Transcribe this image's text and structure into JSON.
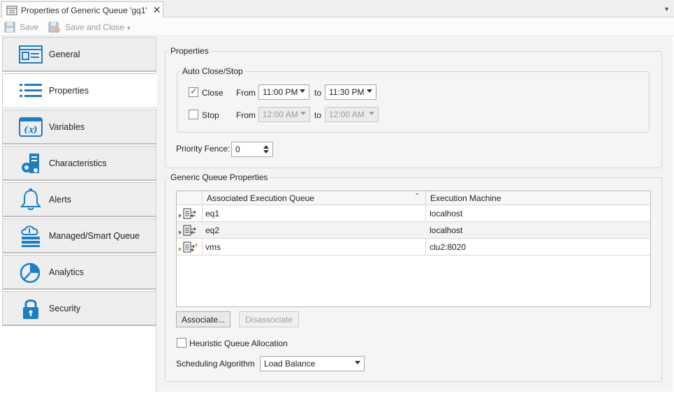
{
  "tab": {
    "title": "Properties of Generic Queue 'gq1'",
    "close": "✕"
  },
  "toolbar": {
    "save": "Save",
    "save_close": "Save and Close"
  },
  "nav": [
    {
      "label": "General",
      "icon": "general-icon"
    },
    {
      "label": "Properties",
      "icon": "list-icon"
    },
    {
      "label": "Variables",
      "icon": "variables-icon"
    },
    {
      "label": "Characteristics",
      "icon": "characteristics-icon"
    },
    {
      "label": "Alerts",
      "icon": "bell-icon"
    },
    {
      "label": "Managed/Smart Queue",
      "icon": "cloud-server-icon"
    },
    {
      "label": "Analytics",
      "icon": "pie-chart-icon"
    },
    {
      "label": "Security",
      "icon": "lock-icon"
    }
  ],
  "properties": {
    "title": "Properties",
    "autoclose": {
      "title": "Auto Close/Stop",
      "close_label": "Close",
      "close_checked": true,
      "stop_label": "Stop",
      "stop_checked": false,
      "from": "From",
      "to": "to",
      "close_from": "11:00 PM",
      "close_to": "11:30 PM",
      "stop_from": "12:00 AM",
      "stop_to": "12:00 AM"
    },
    "priority_label": "Priority Fence:",
    "priority_value": "0"
  },
  "gq": {
    "title": "Generic Queue Properties",
    "columns": [
      "Associated Execution Queue",
      "Execution Machine"
    ],
    "rows": [
      {
        "queue": "eq1",
        "machine": "localhost"
      },
      {
        "queue": "eq2",
        "machine": "localhost"
      },
      {
        "queue": "vms",
        "machine": "clu2:8020"
      }
    ],
    "associate": "Associate...",
    "disassociate": "Disassociate",
    "heuristic_label": "Heuristic Queue Allocation",
    "sched_label": "Scheduling Algorithm",
    "sched_value": "Load Balance"
  },
  "colors": {
    "accent": "#1a7fc6",
    "orange": "#e08a1a"
  }
}
